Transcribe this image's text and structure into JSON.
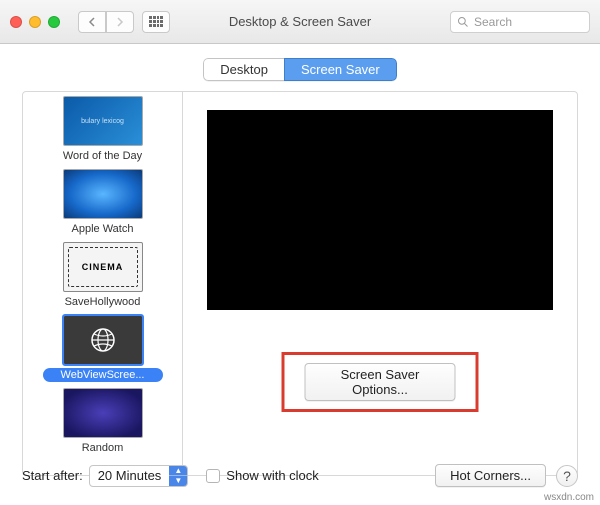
{
  "window": {
    "title": "Desktop & Screen Saver",
    "search_placeholder": "Search"
  },
  "tabs": {
    "desktop": "Desktop",
    "screen_saver": "Screen Saver",
    "active": "screen_saver"
  },
  "screensavers": [
    {
      "id": "wotd",
      "label": "Word of the Day",
      "selected": false
    },
    {
      "id": "applewatch",
      "label": "Apple Watch",
      "selected": false
    },
    {
      "id": "savehw",
      "label": "SaveHollywood",
      "selected": false,
      "thumb_text": "CINEMA"
    },
    {
      "id": "webview",
      "label": "WebViewScree...",
      "selected": true
    },
    {
      "id": "random",
      "label": "Random",
      "selected": false
    }
  ],
  "options_button": "Screen Saver Options...",
  "footer": {
    "start_after_label": "Start after:",
    "start_after_value": "20 Minutes",
    "show_with_clock": "Show with clock",
    "hot_corners": "Hot Corners...",
    "help": "?"
  },
  "watermark": "wsxdn.com",
  "colors": {
    "accent": "#3b82f6",
    "highlight_box": "#d93c2f"
  }
}
